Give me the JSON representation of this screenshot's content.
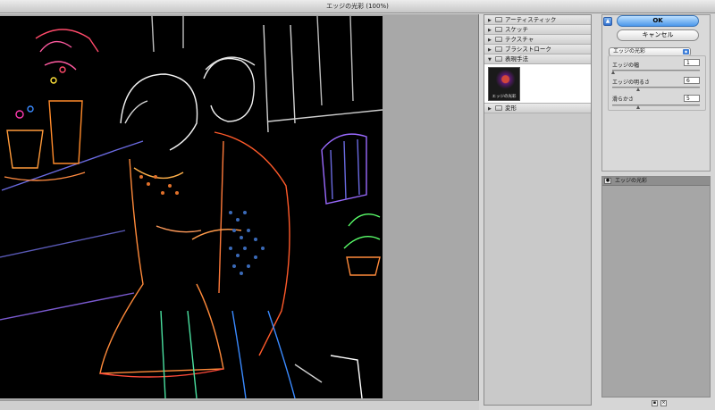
{
  "window": {
    "title": "エッジの光彩 (100%)"
  },
  "gallery": {
    "categories": [
      {
        "label": "アーティスティック",
        "expanded": false
      },
      {
        "label": "スケッチ",
        "expanded": false
      },
      {
        "label": "テクスチャ",
        "expanded": false
      },
      {
        "label": "ブラシストローク",
        "expanded": false
      },
      {
        "label": "表現手法",
        "expanded": true
      },
      {
        "label": "変形",
        "expanded": false
      }
    ],
    "selected_thumb": "エッジの光彩"
  },
  "buttons": {
    "ok": "OK",
    "cancel": "キャンセル",
    "help": "▲"
  },
  "filter": {
    "selected": "エッジの光彩"
  },
  "params": [
    {
      "label": "エッジの幅",
      "value": "1",
      "slider_pct": 5
    },
    {
      "label": "エッジの明るさ",
      "value": "6",
      "slider_pct": 30
    },
    {
      "label": "滑らかさ",
      "value": "5",
      "slider_pct": 33
    }
  ],
  "layers": {
    "active": "エッジの光彩"
  },
  "colors": {
    "ok_blue": "#4b97ea",
    "canvas_bg": "#000000",
    "preview_bg": "#a8a8a8"
  },
  "icons": [
    "expand-triangle-icon",
    "folder-icon",
    "eye-icon",
    "new-layer-icon",
    "trash-icon",
    "select-arrow-icon"
  ]
}
